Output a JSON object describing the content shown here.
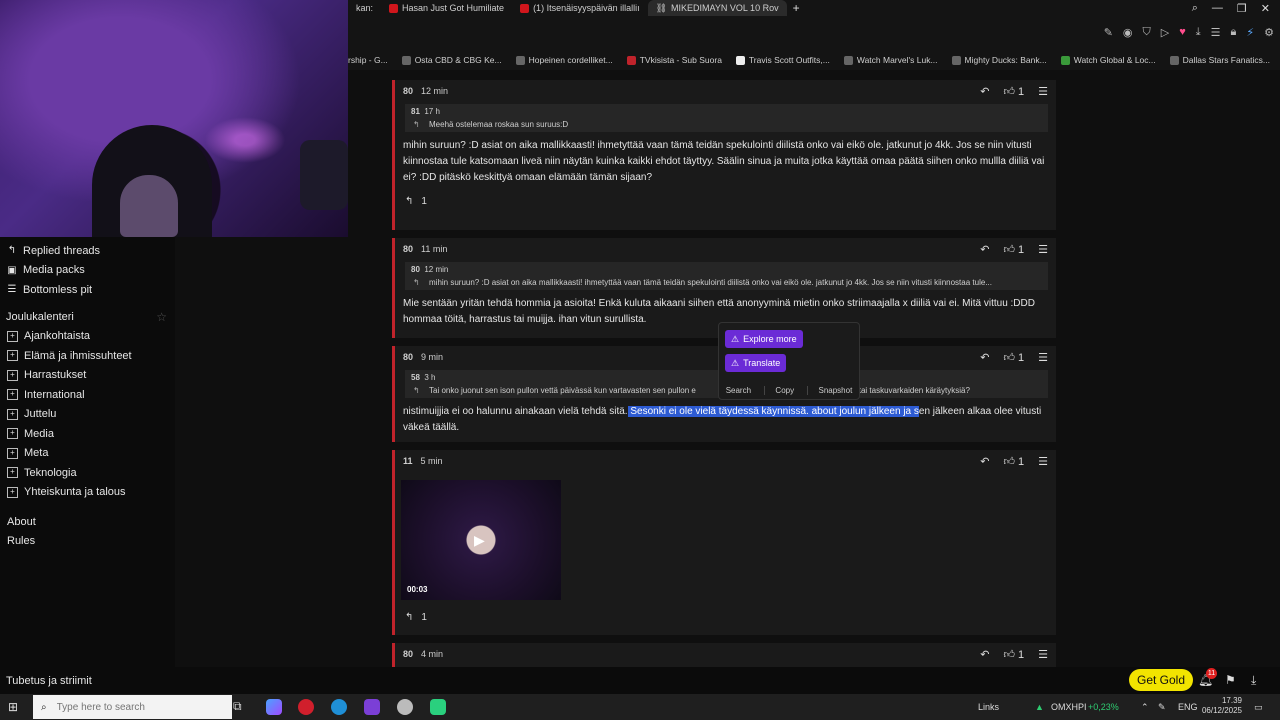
{
  "browser": {
    "tabs": [
      {
        "label": "kan:",
        "active": false
      },
      {
        "label": "Hasan Just Got Humiliate",
        "active": false
      },
      {
        "label": "(1) Itsenäisyyspäivän illalliı",
        "active": false
      },
      {
        "label": "MIKEDIMAYN VOL 10 Rov",
        "active": true
      }
    ],
    "bookmarks": [
      "rship - G...",
      "Osta CBD & CBG Ke...",
      "Hopeinen cordelliket...",
      "TVkisista - Sub Suora",
      "Travis Scott Outfits,...",
      "Watch Marvel's Luk...",
      "Mighty Ducks: Bank...",
      "Watch Global & Loc...",
      "Dallas Stars Fanatics..."
    ]
  },
  "sidebar": {
    "top_items": [
      {
        "label": "Replied threads",
        "icon": "reply-icon"
      },
      {
        "label": "Media packs",
        "icon": "media-icon"
      },
      {
        "label": "Bottomless pit",
        "icon": "list-icon"
      }
    ],
    "heading": "Joulukalenteri",
    "categories": [
      "Ajankohtaista",
      "Elämä ja ihmissuhteet",
      "Harrastukset",
      "International",
      "Juttelu",
      "Media",
      "Meta",
      "Teknologia",
      "Yhteiskunta ja talous"
    ],
    "bottom_links": [
      "About",
      "Rules"
    ]
  },
  "posts": [
    {
      "id": "80",
      "time": "12 min",
      "likes": "1",
      "quote": {
        "id": "81",
        "time": "17 h",
        "text": "Meehä ostelemaa roskaa sun suruus:D"
      },
      "body": "mihin suruun? :D asiat on aika mallikkaasti! ihmetyttää vaan tämä teidän spekulointi diilistä onko vai eikö ole. jatkunut jo 4kk. Jos se niin vitusti kiinnostaa tule katsomaan liveä niin näytän kuinka kaikki ehdot täyttyy. Säälin sinua ja muita jotka käyttää omaa päätä siihen onko mullla diiliä vai ei? :DD pitäskö keskittyä omaan elämään tämän sijaan?",
      "replies": "1"
    },
    {
      "id": "80",
      "time": "11 min",
      "likes": "1",
      "quote": {
        "id": "80",
        "time": "12 min",
        "text": "mihin suruun? :D asiat on aika mallikkaasti! ihmetyttää vaan tämä teidän spekulointi diilistä onko vai eikö ole. jatkunut jo 4kk. Jos se niin vitusti kiinnostaa tule..."
      },
      "body": "Mie sentään yritän tehdä hommia ja asioita! Enkä kuluta aikaani siihen että anonyyminä mietin onko striimaajalla x diiliä vai ei. Mitä vittuu :DDD hommaa töitä, harrastus tai muijja. ihan vitun surullista."
    },
    {
      "id": "80",
      "time": "9 min",
      "likes": "1",
      "quote": {
        "id": "58",
        "time": "3 h",
        "text": "Tai onko juonut sen ison pullon vettä päivässä kun vartavasten sen pullon e",
        "text_tail": "elu tai taskuvarkaiden käräytyksiä?"
      },
      "body_pre": "nistimuijjia ei oo halunnu ainakaan vielä tehdä sitä.",
      "body_hl": " Sesonki ei ole vielä täydessä käynnissä. about joulun jälkeen ja s",
      "body_post": "en jälkeen alkaa olee vitusti väkeä täällä."
    },
    {
      "id": "11",
      "time": "5 min",
      "likes": "1",
      "video_duration": "00:03",
      "replies": "1"
    },
    {
      "id": "80",
      "time": "4 min",
      "likes": "1"
    }
  ],
  "popup": {
    "explore": "Explore more",
    "translate": "Translate",
    "search": "Search",
    "copy": "Copy",
    "snapshot": "Snapshot"
  },
  "footer": {
    "board_name": "Tubetus ja striimit",
    "gold_button": "Get Gold",
    "notifications": "11"
  },
  "taskbar": {
    "search_placeholder": "Type here to search",
    "links_label": "Links",
    "stock": "OMXHPI",
    "stock_change": "+0,23%",
    "language": "ENG",
    "time": "17.39",
    "date": "06/12/2025"
  },
  "colors": {
    "accent_red": "#c0232b",
    "highlight_blue": "#2d5bd3",
    "gold": "#f2e400",
    "popup_purple": "#6b2bd6"
  }
}
